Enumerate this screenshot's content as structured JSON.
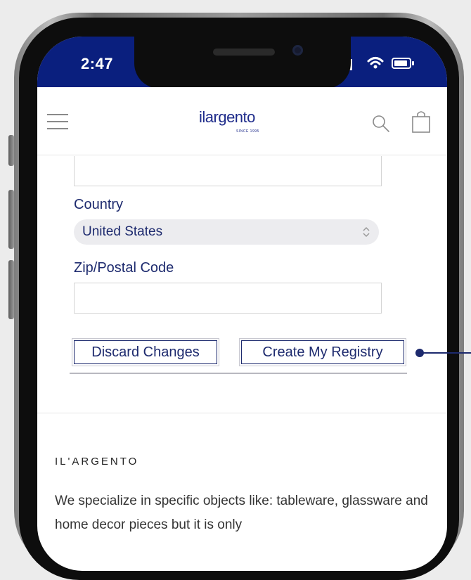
{
  "status_bar": {
    "time": "2:47",
    "background": "#0a1f7e"
  },
  "header": {
    "menu_icon": "hamburger-menu-icon",
    "logo_text": "ilargento",
    "logo_tagline": "SINCE 1995",
    "search_icon": "search-icon",
    "bag_icon": "shopping-bag-icon"
  },
  "form": {
    "country_label": "Country",
    "country_value": "United States",
    "zip_label": "Zip/Postal Code",
    "zip_value": "",
    "discard_button": "Discard Changes",
    "create_button": "Create My Registry"
  },
  "footer": {
    "heading": "IL'ARGENTO",
    "text": "We specialize in specific objects like: tableware, glassware and home decor pieces but it is only"
  },
  "colors": {
    "brand": "#1d2a6e",
    "status_bar": "#0a1f7e"
  }
}
